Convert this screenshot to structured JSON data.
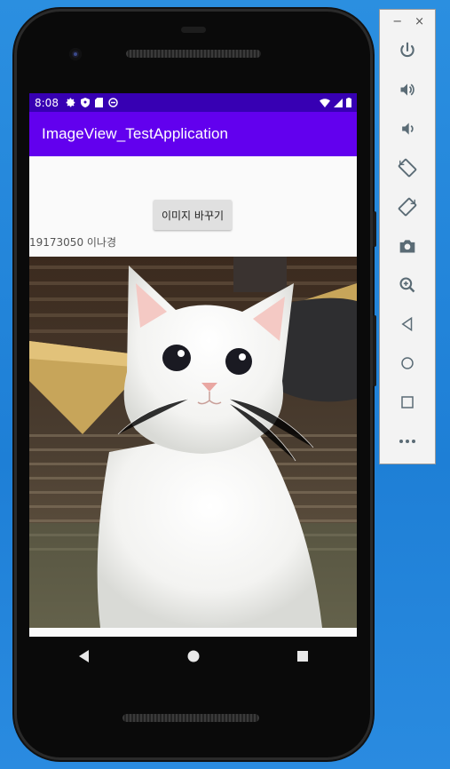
{
  "statusbar": {
    "time": "8:08",
    "icons_left": [
      "settings-icon",
      "shield-icon",
      "sd-card-icon",
      "sync-icon"
    ],
    "icons_right": [
      "wifi-icon",
      "signal-icon",
      "battery-icon"
    ]
  },
  "appbar": {
    "title": "ImageView_TestApplication"
  },
  "content": {
    "button_label": "이미지 바꾸기",
    "caption": "19173050 이나경",
    "image": "white-kitten-photo"
  },
  "navbar": {
    "buttons": [
      "back-icon",
      "home-icon",
      "recents-icon"
    ]
  },
  "emulator_toolbar": {
    "window_controls": [
      "−",
      "×"
    ],
    "items": [
      "power-icon",
      "volume-up-icon",
      "volume-down-icon",
      "rotate-left-icon",
      "rotate-right-icon",
      "camera-icon",
      "zoom-icon",
      "back-icon",
      "home-icon",
      "overview-icon",
      "more-icon"
    ]
  },
  "colors": {
    "statusbar": "#3700b3",
    "appbar": "#6200ee",
    "desktop": "#1e7fd6"
  }
}
